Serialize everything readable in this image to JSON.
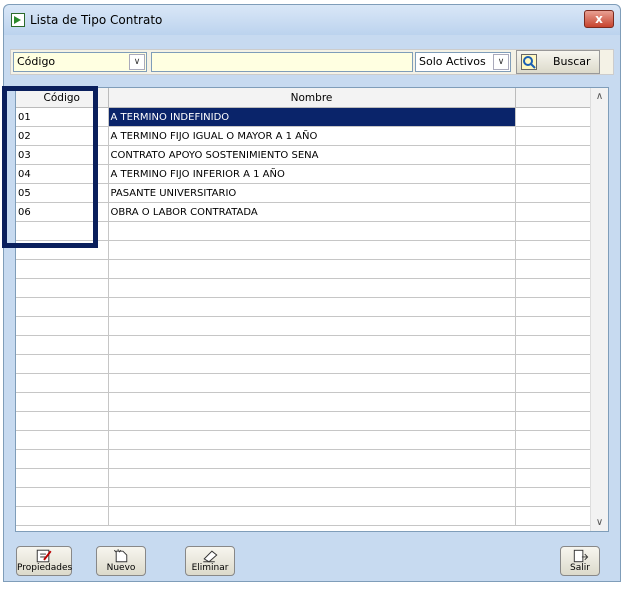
{
  "window": {
    "title": "Lista de Tipo Contrato",
    "close_label": "x"
  },
  "toolbar": {
    "field_combo": {
      "value": "Código"
    },
    "search_value": "",
    "status_combo": {
      "value": "Solo Activos"
    },
    "search_button": "Buscar"
  },
  "grid": {
    "columns": [
      "Código",
      "Nombre"
    ],
    "rows": [
      {
        "codigo": "01",
        "nombre": "A TERMINO INDEFINIDO"
      },
      {
        "codigo": "02",
        "nombre": "A TERMINO FIJO IGUAL O MAYOR A 1 AÑO"
      },
      {
        "codigo": "03",
        "nombre": "CONTRATO APOYO SOSTENIMIENTO SENA"
      },
      {
        "codigo": "04",
        "nombre": "A TERMINO FIJO INFERIOR A 1 AÑO"
      },
      {
        "codigo": "05",
        "nombre": "PASANTE UNIVERSITARIO"
      },
      {
        "codigo": "06",
        "nombre": "OBRA O LABOR CONTRATADA"
      }
    ],
    "selected_row_index": 0
  },
  "buttons": {
    "propiedades": "Propiedades",
    "nuevo": "Nuevo",
    "eliminar": "Eliminar",
    "salir": "Salir"
  },
  "colors": {
    "selection": "#0a246a",
    "highlight_box": "#0a1f5c",
    "input_bg": "#ffffe1"
  }
}
